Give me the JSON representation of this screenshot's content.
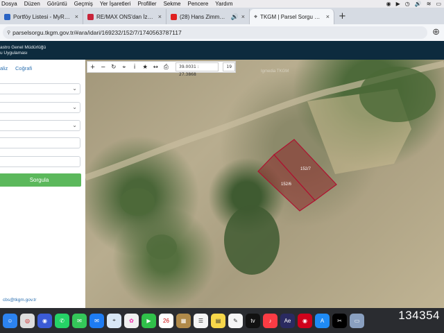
{
  "menubar": {
    "items": [
      "Dosya",
      "Düzen",
      "Görüntü",
      "Geçmiş",
      "Yer İşaretleri",
      "Profiller",
      "Sekme",
      "Pencere",
      "Yardım"
    ]
  },
  "tabs": [
    {
      "title": "Portföy Listesi - MyRemax",
      "favicon_color": "#2b64c4",
      "active": false
    },
    {
      "title": "RE/MAX ONS'dan İzmir Kınık'ta",
      "favicon_color": "#c8243a",
      "active": false
    },
    {
      "title": "(28) Hans Zimmer - S.T.A.Y.",
      "favicon_color": "#e02020",
      "active": false
    },
    {
      "title": "TKGM | Parsel Sorgu Uygulaması",
      "favicon_color": "#222222",
      "active": true
    }
  ],
  "address": {
    "url": "parselsorgu.tkgm.gov.tr/#ara/idari/169232/152/7/1740563787117"
  },
  "site": {
    "line1": "astro Genel Müdürlüğü",
    "line2": "u Uygulaması"
  },
  "panel": {
    "tab1": "aliz",
    "tab2": "Coğrafi",
    "query_button": "Sorgula",
    "email": "cbs@tkgm.gov.tr"
  },
  "map": {
    "coords": "39.0031 : 27.3868",
    "zoom": "19",
    "watermark": "Igmedia TKGM",
    "parcel_1_label": "152/7",
    "parcel_2_label": "152/6"
  },
  "dock": {
    "calendar_day": "26",
    "overlay_number": "134354"
  }
}
